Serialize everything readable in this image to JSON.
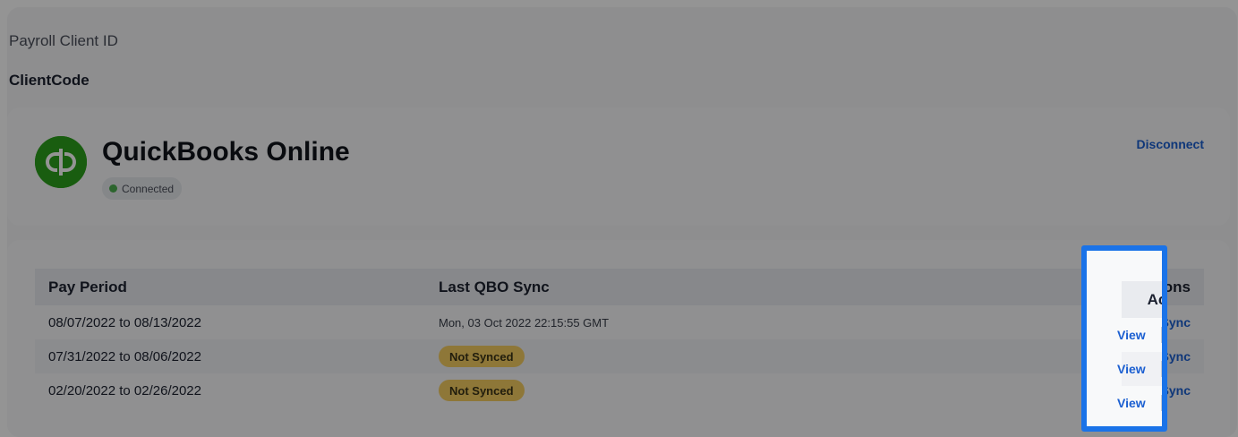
{
  "client": {
    "label": "Payroll Client ID",
    "code": "ClientCode"
  },
  "integration": {
    "name": "QuickBooks Online",
    "logo_icon": "quickbooks-logo-icon",
    "status": "Connected",
    "disconnect_label": "Disconnect"
  },
  "table": {
    "headers": {
      "period": "Pay Period",
      "sync": "Last QBO Sync",
      "actions": "Actions"
    },
    "rows": [
      {
        "period": "08/07/2022 to 08/13/2022",
        "sync": "Mon, 03 Oct 2022 22:15:55 GMT",
        "view": "View",
        "sync_action": "Sync"
      },
      {
        "period": "07/31/2022 to 08/06/2022",
        "sync": "Not Synced",
        "view": "View",
        "sync_action": "Sync"
      },
      {
        "period": "02/20/2022 to 02/26/2022",
        "sync": "Not Synced",
        "view": "View",
        "sync_action": "Sync"
      }
    ]
  },
  "colors": {
    "accent": "#1b5fd1",
    "highlight": "#1a73e8",
    "brand_green": "#2ca01c",
    "not_synced_badge": "#f5cd61"
  }
}
